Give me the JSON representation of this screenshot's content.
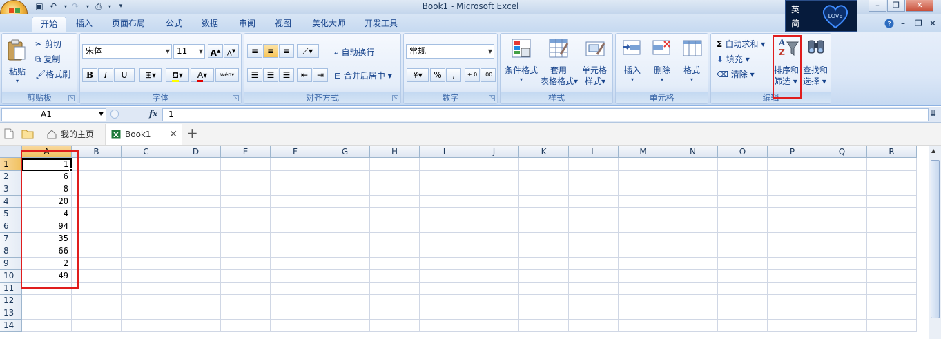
{
  "window": {
    "title": "Book1 - Microsoft Excel"
  },
  "tabs": [
    "开始",
    "插入",
    "页面布局",
    "公式",
    "数据",
    "审阅",
    "视图",
    "美化大师",
    "开发工具"
  ],
  "active_tab": "开始",
  "ime": {
    "lang_top": "英",
    "lang_bottom": "简",
    "badge": "LOVE"
  },
  "ribbon": {
    "clipboard": {
      "paste": "粘贴",
      "cut": "剪切",
      "copy": "复制",
      "format_painter": "格式刷",
      "label": "剪贴板"
    },
    "font": {
      "name": "宋体",
      "size": "11",
      "label": "字体",
      "bold": "B",
      "italic": "I",
      "underline": "U",
      "grow": "A",
      "shrink": "A",
      "color_a": "A",
      "phonetic": "wén"
    },
    "alignment": {
      "wrap": "自动换行",
      "merge": "合并后居中",
      "label": "对齐方式"
    },
    "number": {
      "format": "常规",
      "percent": "%",
      "comma": ",",
      "label": "数字",
      "inc_decimal": "+.0",
      "dec_decimal": ".00"
    },
    "styles": {
      "conditional": "条件格式",
      "table_line1": "套用",
      "table_line2": "表格格式",
      "cell_line1": "单元格",
      "cell_line2": "样式",
      "label": "样式"
    },
    "cells": {
      "insert": "插入",
      "delete": "删除",
      "format": "格式",
      "label": "单元格"
    },
    "editing": {
      "autosum": "自动求和",
      "fill": "填充",
      "clear": "清除",
      "sort_line1": "排序和",
      "sort_line2": "筛选",
      "find_line1": "查找和",
      "find_line2": "选择",
      "label": "编辑"
    }
  },
  "formula_bar": {
    "name_box": "A1",
    "fx": "fx",
    "value": "1"
  },
  "doc_tabs": {
    "home": "我的主页",
    "book": "Book1"
  },
  "columns": [
    "A",
    "B",
    "C",
    "D",
    "E",
    "F",
    "G",
    "H",
    "I",
    "J",
    "K",
    "L",
    "M",
    "N",
    "O",
    "P",
    "Q",
    "R"
  ],
  "rows": [
    "1",
    "2",
    "3",
    "4",
    "5",
    "6",
    "7",
    "8",
    "9",
    "10",
    "11",
    "12",
    "13",
    "14"
  ],
  "column_a_values": [
    "1",
    "6",
    "8",
    "20",
    "4",
    "94",
    "35",
    "66",
    "2",
    "49"
  ],
  "colors": {
    "highlight": "#e01d1d",
    "selected_header": "#f1c15f"
  }
}
